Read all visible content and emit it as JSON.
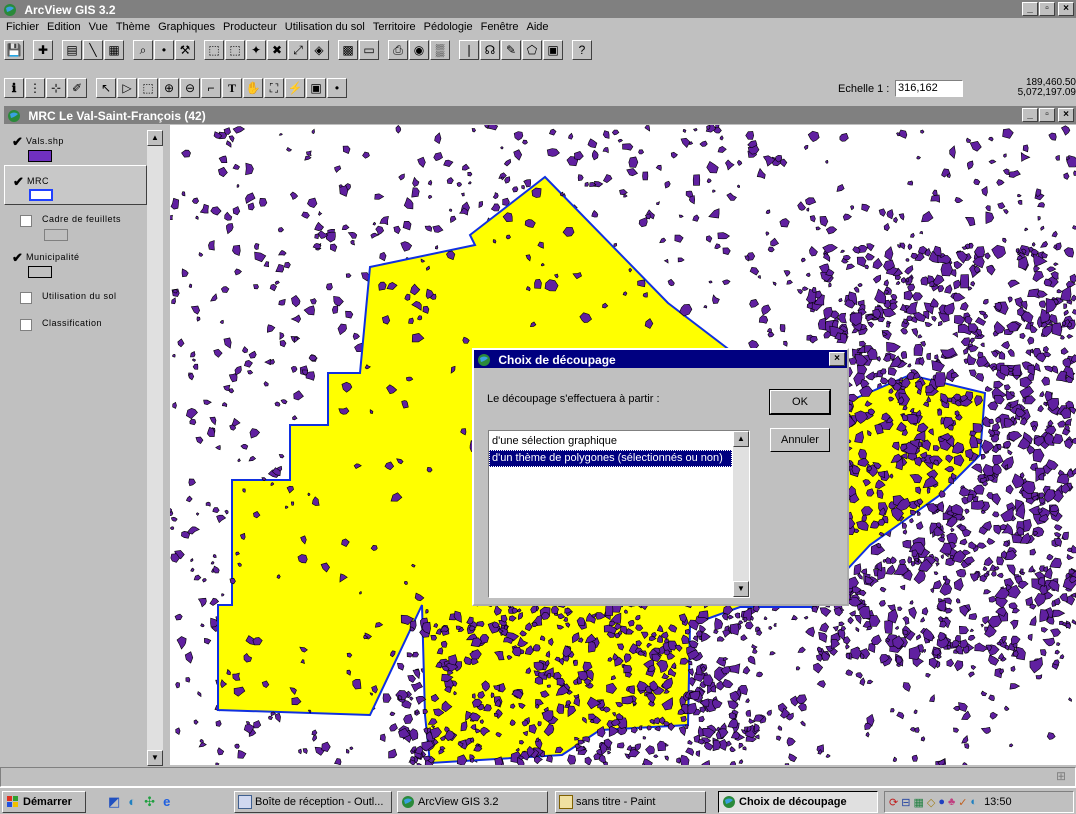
{
  "app": {
    "title": "ArcView GIS 3.2"
  },
  "menu": [
    "Fichier",
    "Edition",
    "Vue",
    "Thème",
    "Graphiques",
    "Producteur",
    "Utilisation du sol",
    "Territoire",
    "Pédologie",
    "Fenêtre",
    "Aide"
  ],
  "toolbar": {
    "scale_label": "Echelle 1 :",
    "scale_value": "316,162",
    "coord_x": "189,460.50",
    "coord_y": "5,072,197.09"
  },
  "view": {
    "title": "MRC Le Val-Saint-François (42)"
  },
  "legend": {
    "items": [
      {
        "label": "Vals.shp",
        "checked": true,
        "swatch": "#7030c0"
      },
      {
        "label": "MRC",
        "checked": true,
        "swatch": "#2040ff"
      },
      {
        "label": "Cadre de feuillets",
        "checked": false,
        "swatch": "#c0c0c0"
      },
      {
        "label": "Municipalité",
        "checked": true,
        "swatch": "#c0c0c0"
      },
      {
        "label": "Utilisation du sol",
        "checked": false
      },
      {
        "label": "Classification",
        "checked": false
      }
    ]
  },
  "dialog": {
    "title": "Choix de découpage",
    "prompt": "Le découpage s'effectuera à partir :",
    "options": [
      "d'une sélection graphique",
      "d'un thème de polygones (sélectionnés ou non)"
    ],
    "selected_index": 1,
    "ok_label": "OK",
    "cancel_label": "Annuler"
  },
  "taskbar": {
    "start_label": "Démarrer",
    "tasks": [
      {
        "label": "Boîte de réception - Outl...",
        "active": false
      },
      {
        "label": "ArcView GIS 3.2",
        "active": false
      },
      {
        "label": "sans titre - Paint",
        "active": false
      },
      {
        "label": "Choix de découpage",
        "active": true
      }
    ],
    "clock": "13:50"
  },
  "colors": {
    "map_yellow": "#ffff00",
    "map_purple": "#6020a0",
    "mrc_border": "#1030e0",
    "title_active": "#000080"
  }
}
